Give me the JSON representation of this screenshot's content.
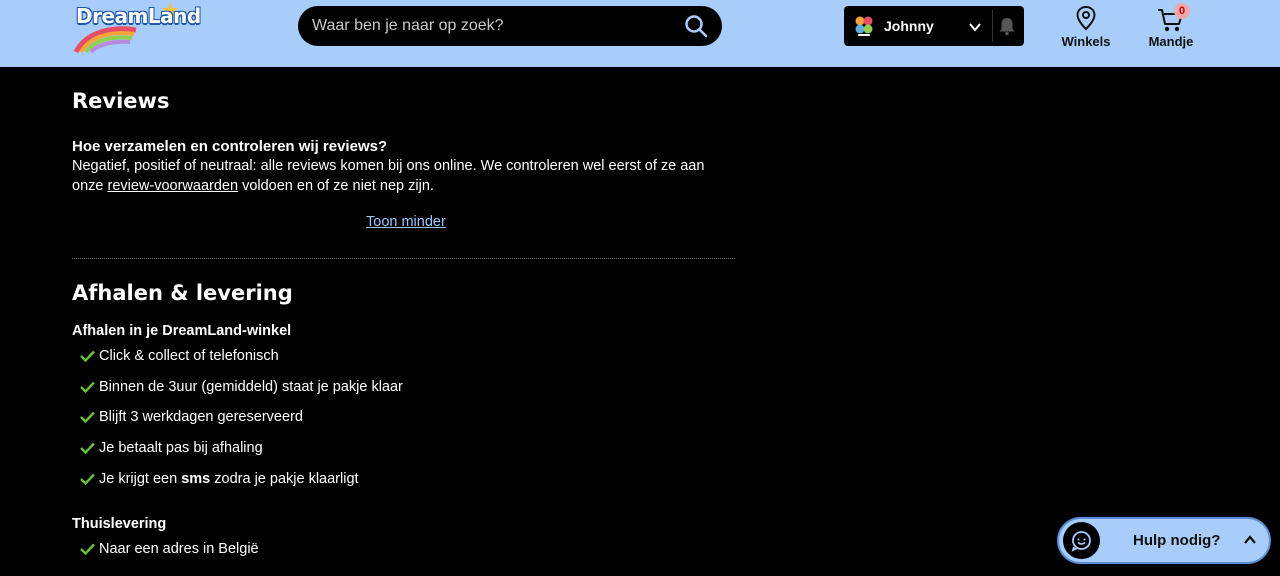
{
  "header": {
    "logo": {
      "text": "DreamLand"
    },
    "search": {
      "placeholder": "Waar ben je naar op zoek?"
    },
    "user": {
      "name": "Johnny"
    },
    "nav": {
      "stores_label": "Winkels",
      "cart_label": "Mandje",
      "cart_count": "0"
    }
  },
  "reviews": {
    "title": "Reviews",
    "question": "Hoe verzamelen en controleren wij reviews?",
    "text_before": "Negatief, positief of neutraal: alle reviews komen bij ons online. We controleren wel eerst of ze aan onze ",
    "link": "review-voorwaarden",
    "text_after": " voldoen en of ze niet nep zijn.",
    "toggle": "Toon minder"
  },
  "delivery": {
    "title": "Afhalen & levering",
    "pickup": {
      "title": "Afhalen in je DreamLand-winkel",
      "items": [
        {
          "text": "Click & collect of telefonisch"
        },
        {
          "text": "Binnen de 3uur (gemiddeld) staat je pakje klaar"
        },
        {
          "text": "Blijft 3 werkdagen gereserveerd"
        },
        {
          "text": "Je betaalt pas bij afhaling"
        },
        {
          "pre": "Je krijgt een ",
          "bold": "sms",
          "post": " zodra je pakje klaarligt"
        }
      ]
    },
    "home": {
      "title": "Thuislevering",
      "items": [
        {
          "text": "Naar een adres in België"
        }
      ]
    }
  },
  "help": {
    "label": "Hulp nodig?"
  },
  "colors": {
    "header_bg": "#a9cdfb",
    "check": "#6bbf3a",
    "link": "#9cc4ff"
  },
  "icons": [
    "search-icon",
    "user-avatar-icon",
    "chevron-down-icon",
    "bell-icon",
    "location-pin-icon",
    "cart-icon",
    "check-icon",
    "chat-icon",
    "chevron-up-icon"
  ]
}
